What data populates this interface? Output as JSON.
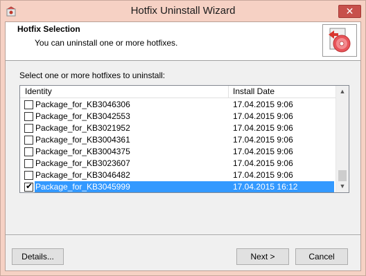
{
  "window": {
    "title": "Hotfix Uninstall Wizard",
    "close_label": "✕"
  },
  "header": {
    "title": "Hotfix Selection",
    "subtitle": "You can uninstall one or more hotfixes."
  },
  "prompt": "Select one or more hotfixes to uninstall:",
  "list": {
    "columns": [
      "Identity",
      "Install Date"
    ],
    "rows": [
      {
        "identity": "Package_for_KB3046306",
        "date": "17.04.2015 9:06",
        "checked": false,
        "selected": false
      },
      {
        "identity": "Package_for_KB3042553",
        "date": "17.04.2015 9:06",
        "checked": false,
        "selected": false
      },
      {
        "identity": "Package_for_KB3021952",
        "date": "17.04.2015 9:06",
        "checked": false,
        "selected": false
      },
      {
        "identity": "Package_for_KB3004361",
        "date": "17.04.2015 9:06",
        "checked": false,
        "selected": false
      },
      {
        "identity": "Package_for_KB3004375",
        "date": "17.04.2015 9:06",
        "checked": false,
        "selected": false
      },
      {
        "identity": "Package_for_KB3023607",
        "date": "17.04.2015 9:06",
        "checked": false,
        "selected": false
      },
      {
        "identity": "Package_for_KB3046482",
        "date": "17.04.2015 9:06",
        "checked": false,
        "selected": false
      },
      {
        "identity": "Package_for_KB3045999",
        "date": "17.04.2015 16:12",
        "checked": true,
        "selected": true
      }
    ]
  },
  "buttons": {
    "details": "Details...",
    "next": "Next >",
    "cancel": "Cancel"
  },
  "colors": {
    "frame": "#f6d1c4",
    "close": "#c7504b",
    "selection": "#3399ff"
  }
}
